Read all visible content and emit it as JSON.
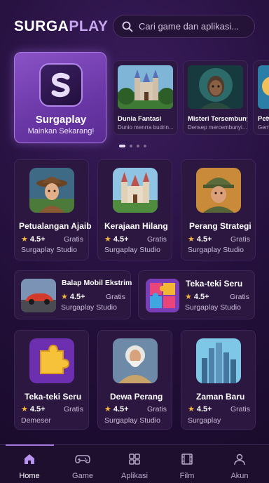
{
  "header": {
    "logo_part1": "SURGA",
    "logo_part2": "PLAY",
    "search_placeholder": "Cari game dan aplikasi..."
  },
  "hero": {
    "title": "Surgaplay",
    "subtitle": "Mainkan Sekarang!"
  },
  "featured": [
    {
      "title": "Dunia Fantasi",
      "subtitle": "Dunio menrra budrin..."
    },
    {
      "title": "Misteri Tersembunyi",
      "subtitle": "Densep mercembunyi..."
    },
    {
      "title": "Petw",
      "subtitle": "Geme"
    }
  ],
  "carousel": {
    "count": 4,
    "active": 0
  },
  "grid_row1": [
    {
      "title": "Petualangan Ajaib",
      "rating": "4.5+",
      "price": "Gratis",
      "developer": "Surgaplay Studio"
    },
    {
      "title": "Kerajaan Hilang",
      "rating": "4.5+",
      "price": "Gratis",
      "developer": "Surgaplay Studio"
    },
    {
      "title": "Perang Strategi",
      "rating": "4.5+",
      "price": "Gratis",
      "developer": "Surgaplay Studio"
    }
  ],
  "grid_row2": [
    {
      "title": "Balap Mobil Ekstrim",
      "rating": "4.5+",
      "price": "Gratis",
      "developer": "Surgaplay Studio"
    },
    {
      "title": "Teka-teki Seru",
      "rating": "4.5+",
      "price": "Gratis",
      "developer": "Surgaplay Studio"
    }
  ],
  "grid_row3": [
    {
      "title": "Teka-teki Seru",
      "rating": "4.5+",
      "price": "Gratis",
      "developer": "Demeser"
    },
    {
      "title": "Dewa Perang",
      "rating": "4.5+",
      "price": "Gratis",
      "developer": "Surgaplay Studio"
    },
    {
      "title": "Zaman Baru",
      "rating": "4.5+",
      "price": "Gratis",
      "developer": "Surgaplay"
    }
  ],
  "nav": {
    "items": [
      {
        "label": "Home",
        "icon": "home-icon",
        "active": true
      },
      {
        "label": "Game",
        "icon": "gamepad-icon"
      },
      {
        "label": "Aplikasi",
        "icon": "apps-grid-icon"
      },
      {
        "label": "Film",
        "icon": "film-icon"
      },
      {
        "label": "Akun",
        "icon": "user-icon"
      }
    ]
  },
  "colors": {
    "accent": "#a77ae0",
    "star": "#f5b63b",
    "background": "#24103c"
  }
}
